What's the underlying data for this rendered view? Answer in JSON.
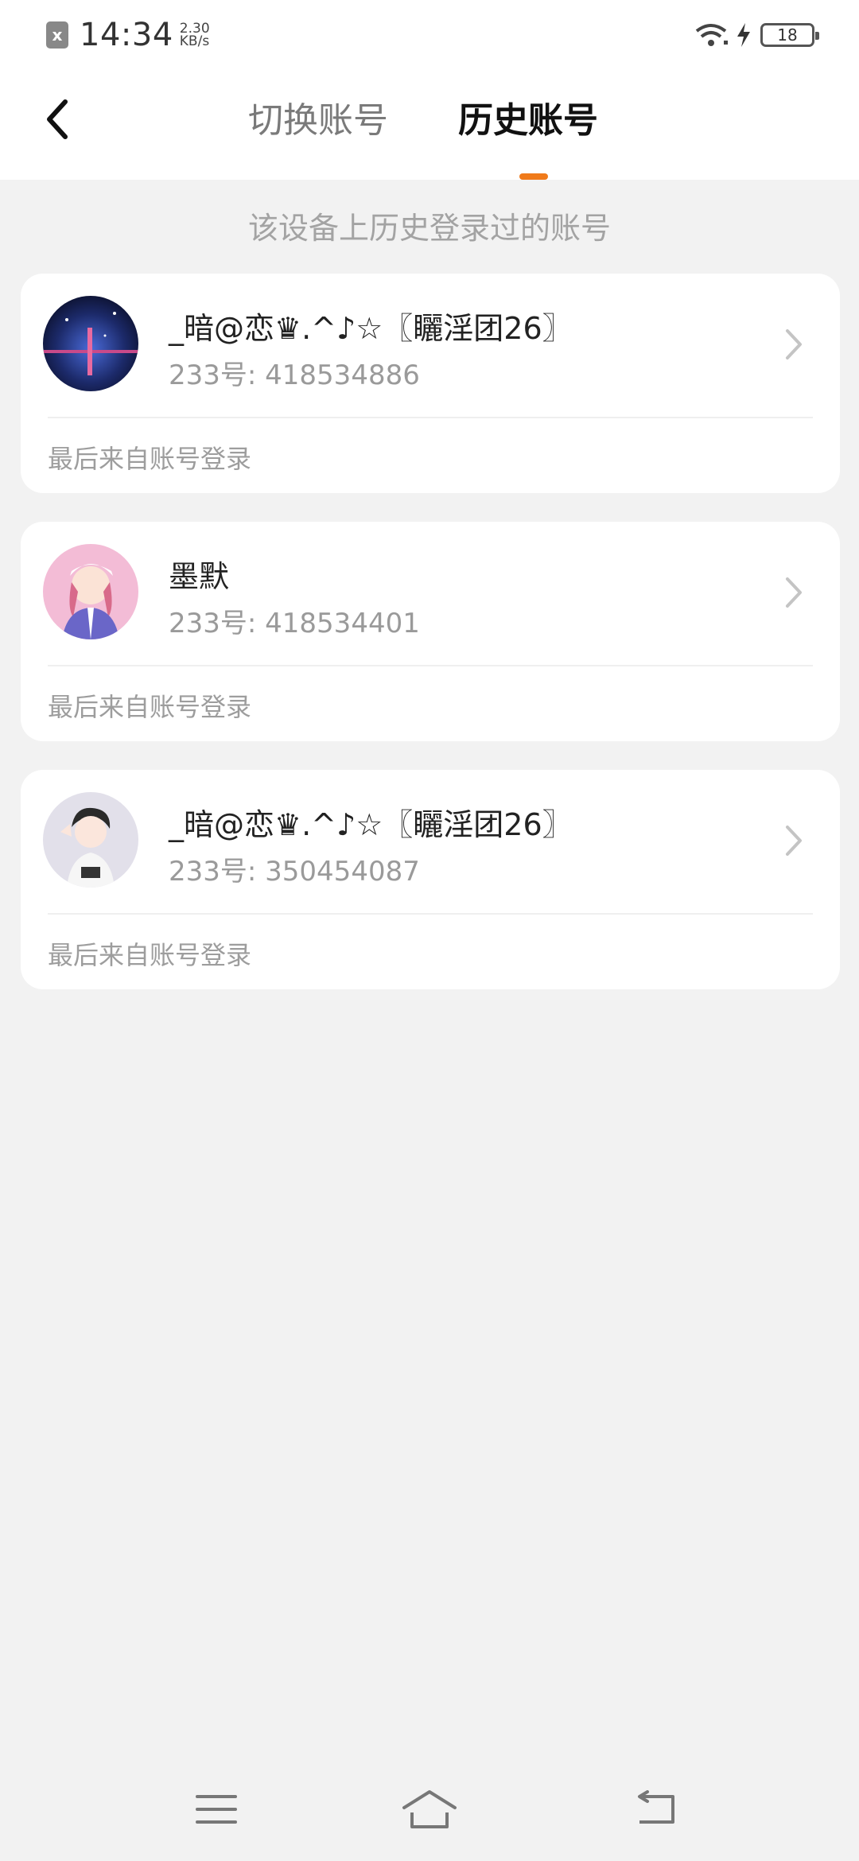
{
  "status_bar": {
    "sim_icon_label": "x",
    "time": "14:34",
    "net_speed_value": "2.30",
    "net_speed_unit": "KB/s",
    "battery": "18",
    "icons": [
      "sim-icon",
      "wifi-icon",
      "charging-icon",
      "battery-icon"
    ]
  },
  "header": {
    "back_icon": "chevron-left-icon",
    "tabs": [
      {
        "label": "切换账号",
        "active": false
      },
      {
        "label": "历史账号",
        "active": true
      }
    ],
    "accent_color": "#f07a1a"
  },
  "subtitle": "该设备上历史登录过的账号",
  "accounts": [
    {
      "name": "_暗@恋♛.^♪☆〖矖淫团26〗",
      "id_text": "233号: 418534886",
      "last_login": "最后来自账号登录",
      "avatar": "night-sky-avatar"
    },
    {
      "name": "墨默",
      "id_text": "233号: 418534401",
      "last_login": "最后来自账号登录",
      "avatar": "anime-girl-avatar"
    },
    {
      "name": "_暗@恋♛.^♪☆〖矖淫团26〗",
      "id_text": "233号: 350454087",
      "last_login": "最后来自账号登录",
      "avatar": "anime-boy-avatar"
    }
  ],
  "nav_bar": {
    "icons": [
      "menu-icon",
      "home-icon",
      "back-icon"
    ]
  }
}
